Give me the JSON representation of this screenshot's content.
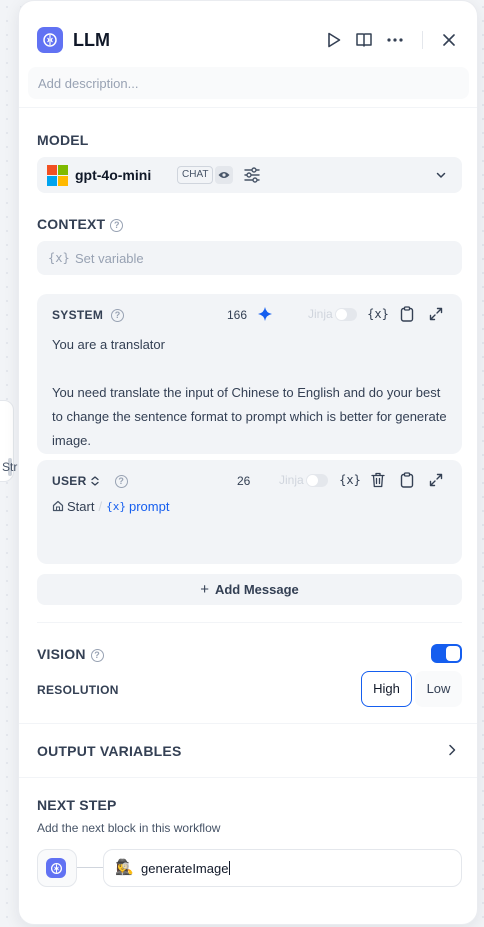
{
  "background": {
    "partial_node_text": "Str"
  },
  "header": {
    "title": "LLM",
    "icons": [
      "brain-icon",
      "play-icon",
      "book-icon",
      "more-icon",
      "close-icon"
    ]
  },
  "description": {
    "placeholder": "Add description..."
  },
  "model": {
    "label": "MODEL",
    "name": "gpt-4o-mini",
    "tag": "CHAT",
    "provider_colors": [
      "#f25022",
      "#7fba00",
      "#00a4ef",
      "#ffb900"
    ]
  },
  "context": {
    "label": "CONTEXT",
    "var_symbol": "{x}",
    "placeholder": "Set variable"
  },
  "system_message": {
    "role": "SYSTEM",
    "count": "166",
    "jinja_label": "Jinja",
    "var_symbol": "{x}",
    "text": "You are a translator\n\nYou need translate the input of Chinese to English and do your best to change the sentence format to prompt which is better for generate image."
  },
  "user_message": {
    "role": "USER",
    "count": "26",
    "jinja_label": "Jinja",
    "var_symbol": "{x}",
    "ref_node": "Start",
    "ref_separator": "/",
    "ref_var_symbol": "{x}",
    "ref_var": "prompt"
  },
  "add_message": {
    "plus": "+",
    "label": "Add Message"
  },
  "vision": {
    "label": "VISION",
    "enabled": true,
    "resolution_label": "RESOLUTION",
    "options": [
      "High",
      "Low"
    ],
    "selected": "High"
  },
  "output_variables": {
    "label": "OUTPUT VARIABLES"
  },
  "next_step": {
    "label": "NEXT STEP",
    "subtitle": "Add the next block in this workflow",
    "target_emoji": "🕵️‍♀️",
    "target_name": "generateImage"
  },
  "colors": {
    "accent": "#155eef",
    "node_icon": "#6172f3",
    "input_bg": "#f2f4f7"
  }
}
